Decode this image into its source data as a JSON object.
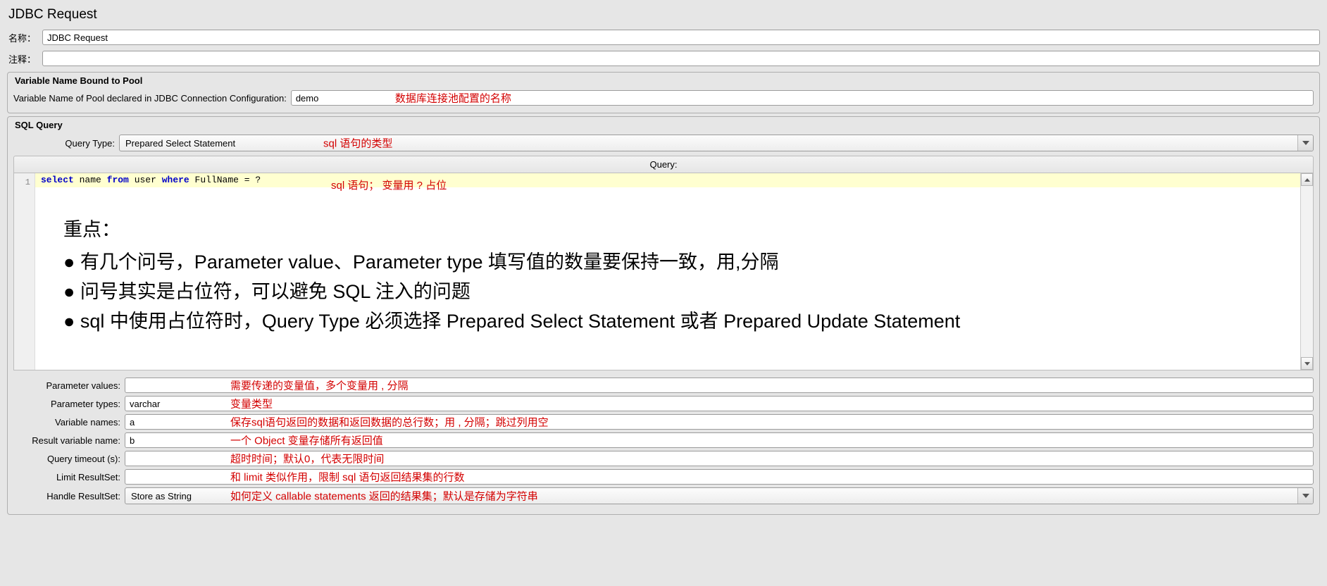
{
  "title": "JDBC Request",
  "labels": {
    "name": "名称：",
    "comment": "注释："
  },
  "name_value": "JDBC Request",
  "comment_value": "",
  "section_pool": {
    "title": "Variable Name Bound to Pool",
    "label": "Variable Name of Pool declared in JDBC Connection Configuration:",
    "value": "demo",
    "anno": "数据库连接池配置的名称"
  },
  "section_sql": {
    "title": "SQL Query",
    "query_type_label": "Query Type:",
    "query_type_value": "Prepared Select Statement",
    "query_type_anno": "sql 语句的类型",
    "query_header": "Query:",
    "line_no": "1",
    "sql_tokens": {
      "select": "select",
      "name": "name",
      "from": "from",
      "user": "user",
      "where": "where",
      "rest": " FullName = ?"
    },
    "sql_anno": "sql 语句；  变量用 ? 占位",
    "notes_title": "重点：",
    "notes": [
      "有几个问号，Parameter value、Parameter type 填写值的数量要保持一致，用,分隔",
      "问号其实是占位符，可以避免 SQL 注入的问题",
      "sql 中使用占位符时，Query Type 必须选择 Prepared Select Statement 或者 Prepared Update Statement"
    ]
  },
  "bottom": [
    {
      "label": "Parameter values:",
      "value": "",
      "anno": "需要传递的变量值，多个变量用 , 分隔",
      "type": "text"
    },
    {
      "label": "Parameter types:",
      "value": "varchar",
      "anno": "变量类型",
      "type": "text"
    },
    {
      "label": "Variable names:",
      "value": "a",
      "anno": "保存sql语句返回的数据和返回数据的总行数；用 , 分隔；跳过列用空",
      "type": "text"
    },
    {
      "label": "Result variable name:",
      "value": "b",
      "anno": "一个 Object 变量存储所有返回值",
      "type": "text"
    },
    {
      "label": "Query timeout (s):",
      "value": "",
      "anno": "超时时间；默认0，代表无限时间",
      "type": "text"
    },
    {
      "label": "Limit ResultSet:",
      "value": "",
      "anno": "和 limit 类似作用，限制 sql 语句返回结果集的行数",
      "type": "text"
    },
    {
      "label": "Handle ResultSet:",
      "value": "Store as String",
      "anno": "如何定义 callable statements 返回的结果集；默认是存储为字符串",
      "type": "combo"
    }
  ]
}
